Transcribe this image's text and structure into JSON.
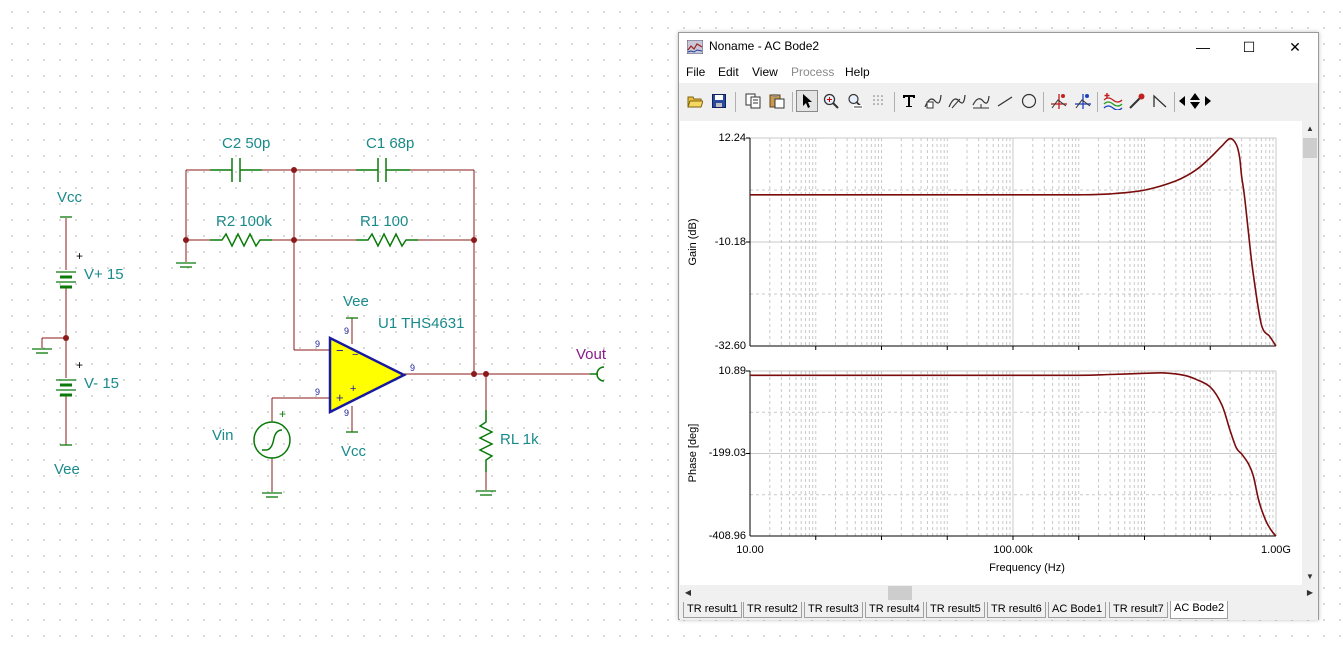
{
  "schematic": {
    "labels": {
      "vcc_top": "Vcc",
      "vplus": "V+ 15",
      "vminus": "V- 15",
      "vee_bottom": "Vee",
      "c2": "C2 50p",
      "c1": "C1 68p",
      "r2": "R2 100k",
      "r1": "R1 100",
      "vee_op": "Vee",
      "u1": "U1 THS4631",
      "vout": "Vout",
      "vin": "Vin",
      "vcc_op": "Vcc",
      "rl": "RL 1k"
    },
    "pin_numbers": {
      "inv": "9",
      "noninv": "9",
      "out": "9",
      "vee_pin": "9",
      "vcc_pin": "9"
    },
    "signs": {
      "plus": "+",
      "minus": "−"
    },
    "colors": {
      "wire": "#8b1a1a",
      "component": "#0a7a0a",
      "label": "#1a8a8a",
      "opamp_fill": "#ffff00",
      "opamp_border": "#1a1aa0"
    }
  },
  "window": {
    "title": "Noname - AC Bode2",
    "controls": {
      "minimize": "—",
      "maximize": "☐",
      "close": "✕"
    },
    "menu": [
      {
        "label": "File",
        "enabled": true
      },
      {
        "label": "Edit",
        "enabled": true
      },
      {
        "label": "View",
        "enabled": true
      },
      {
        "label": "Process",
        "enabled": false
      },
      {
        "label": "Help",
        "enabled": true
      }
    ],
    "toolbar_icons": [
      "open-icon",
      "save-icon",
      "copy-icon",
      "paste-icon",
      "pointer-icon",
      "zoom-in-icon",
      "zoom-100-icon",
      "grid-icon",
      "text-icon",
      "curve-label-icon",
      "curve-label-2-icon",
      "axis-icon",
      "line-icon",
      "circle-icon",
      "cursor-a-icon",
      "cursor-b-icon",
      "curve-add-icon",
      "probe-icon",
      "step-icon",
      "scroll-left-icon",
      "scroll-up-down-icon",
      "scroll-right-icon"
    ],
    "tabs": [
      "TR result1",
      "TR result2",
      "TR result3",
      "TR result4",
      "TR result5",
      "TR result6",
      "AC Bode1",
      "TR result7",
      "AC Bode2"
    ],
    "active_tab": "AC Bode2"
  },
  "chart_data": [
    {
      "type": "line",
      "ylabel": "Gain (dB)",
      "xlabel": "",
      "x_scale": "log",
      "xlim": [
        10,
        1000000000
      ],
      "ylim": [
        -32.6,
        12.24
      ],
      "yticks": [
        "12.24",
        "-10.18",
        "-32.60"
      ],
      "grid": true,
      "series": [
        {
          "color": "#7a0c0c",
          "x": [
            10,
            1000,
            100000,
            1000000,
            3000000,
            10000000,
            30000000,
            60000000,
            100000000,
            150000000,
            200000000,
            250000000,
            280000000,
            300000000,
            330000000,
            380000000,
            450000000,
            600000000,
            800000000,
            1000000000
          ],
          "y": [
            0.0,
            0.0,
            0.0,
            0.0,
            0.2,
            1.0,
            3.0,
            5.3,
            8.0,
            10.5,
            12.1,
            10.8,
            8.0,
            4.0,
            0.0,
            -8.0,
            -17.0,
            -28.0,
            -30.5,
            -32.6
          ]
        }
      ]
    },
    {
      "type": "line",
      "ylabel": "Phase [deg]",
      "xlabel": "Frequency (Hz)",
      "x_scale": "log",
      "xlim": [
        10,
        1000000000
      ],
      "ylim": [
        -408.96,
        10.89
      ],
      "yticks": [
        "10.89",
        "-199.03",
        "-408.96"
      ],
      "xticks": [
        "10.00",
        "100.00k",
        "1.00G"
      ],
      "grid": true,
      "series": [
        {
          "color": "#7a0c0c",
          "x": [
            10,
            1000,
            100000,
            1000000,
            3000000,
            10000000,
            20000000,
            40000000,
            60000000,
            100000000,
            150000000,
            200000000,
            250000000,
            300000000,
            380000000,
            450000000,
            550000000,
            700000000,
            850000000,
            1000000000
          ],
          "y": [
            0,
            0,
            0,
            0,
            2,
            5,
            6,
            0,
            -10,
            -30,
            -75,
            -140,
            -185,
            -200,
            -225,
            -255,
            -320,
            -370,
            -395,
            -408.96
          ]
        }
      ]
    }
  ]
}
